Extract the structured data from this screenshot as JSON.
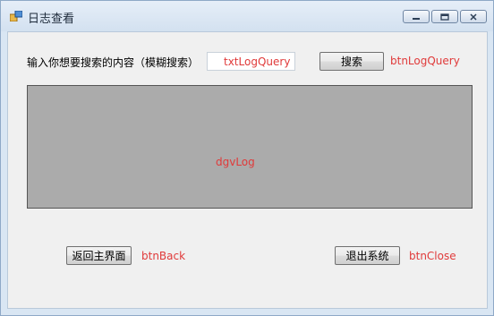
{
  "window": {
    "title": "日志查看"
  },
  "search": {
    "prompt_label": "输入你想要搜索的内容（模糊搜索）",
    "input_value": "",
    "input_placeholder": "txtLogQuery",
    "button_label": "搜索",
    "button_name_hint": "btnLogQuery"
  },
  "grid": {
    "name_hint": "dgvLog"
  },
  "footer": {
    "back_button_label": "返回主界面",
    "back_button_name_hint": "btnBack",
    "exit_button_label": "退出系统",
    "exit_button_name_hint": "btnClose"
  },
  "colors": {
    "hint_text": "#e03a3a",
    "grid_background": "#ababab",
    "client_background": "#f0f0f0"
  },
  "icons": {
    "app": "app-window-icon",
    "minimize": "minimize-icon",
    "maximize": "maximize-icon",
    "close": "close-icon"
  }
}
